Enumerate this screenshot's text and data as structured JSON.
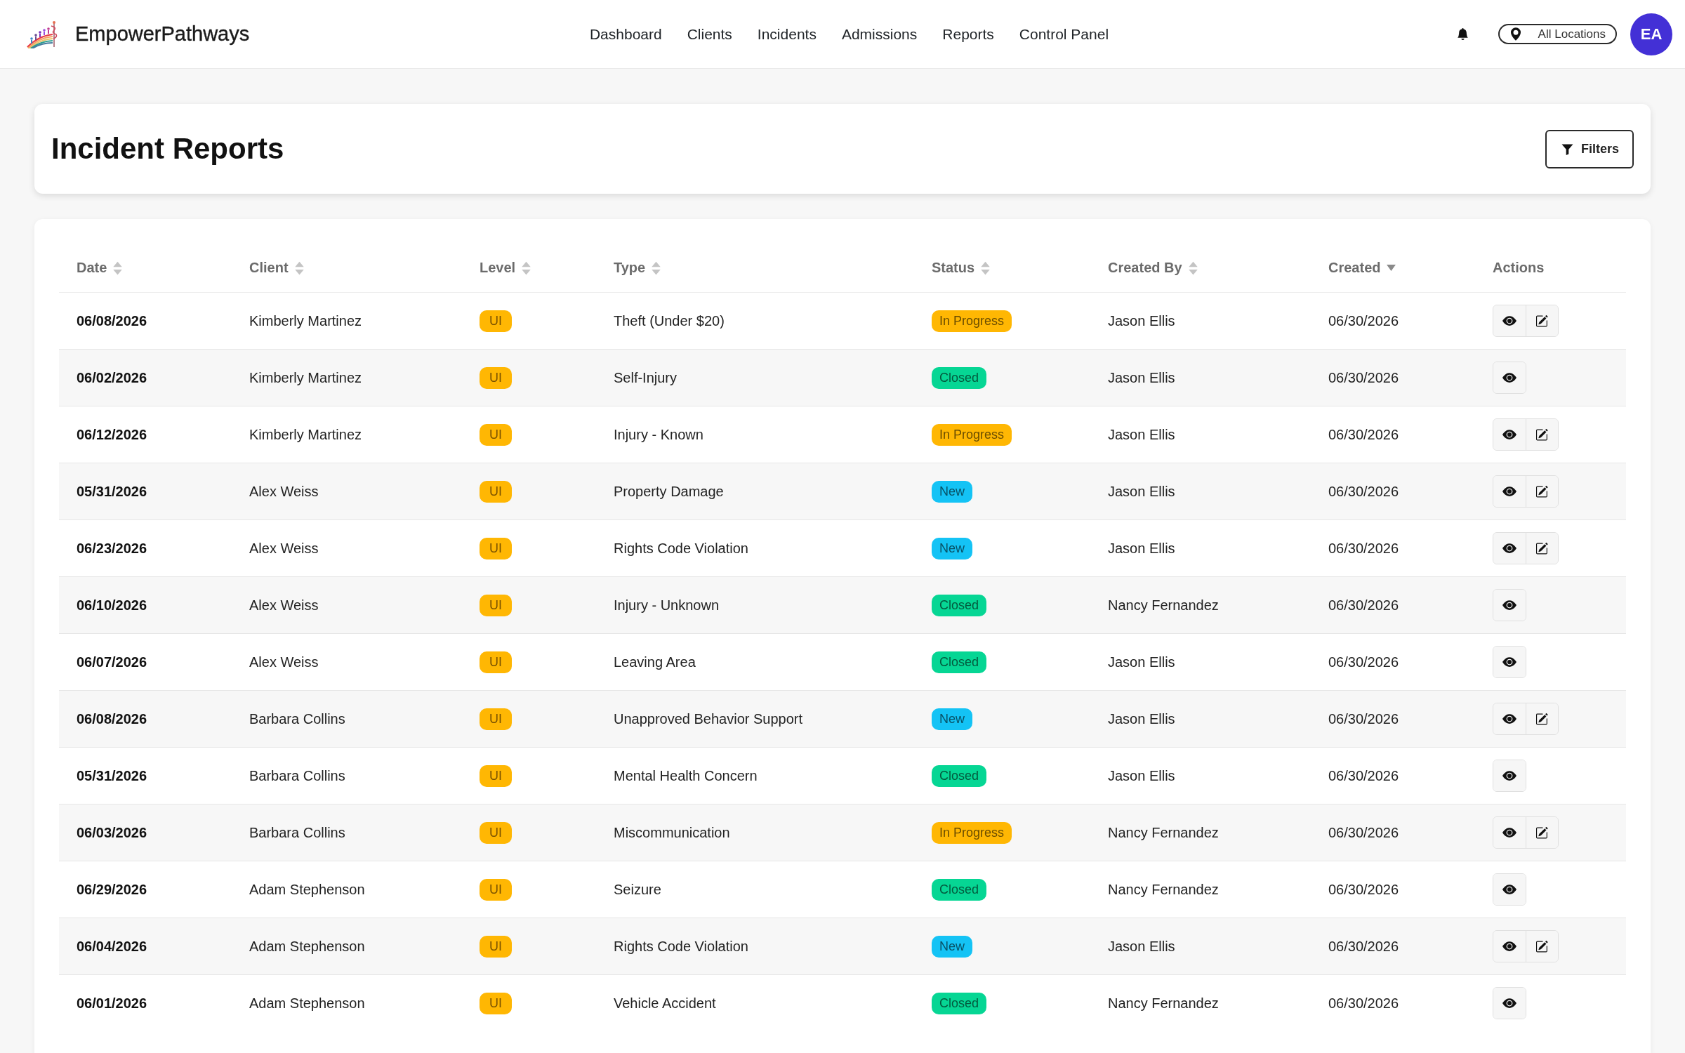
{
  "navbar": {
    "brand": "EmpowerPathways",
    "links": [
      "Dashboard",
      "Clients",
      "Incidents",
      "Admissions",
      "Reports",
      "Control Panel"
    ],
    "location": "All Locations",
    "avatar": "EA"
  },
  "page_header": {
    "title": "Incident Reports",
    "filter_button": "Filters"
  },
  "table": {
    "columns": [
      {
        "label": "Date",
        "sorted": false
      },
      {
        "label": "Client",
        "sorted": false
      },
      {
        "label": "Level",
        "sorted": false
      },
      {
        "label": "Type",
        "sorted": false
      },
      {
        "label": "Status",
        "sorted": false
      },
      {
        "label": "Created By",
        "sorted": false
      },
      {
        "label": "Created",
        "sorted": true
      },
      {
        "label": "Actions"
      }
    ],
    "rows": [
      {
        "date": "06/08/2026",
        "client": "Kimberly Martinez",
        "level": "UI",
        "type": "Theft (Under $20)",
        "status": {
          "label": "In Progress",
          "color": "#ffb703"
        },
        "created_by": "Jason Ellis",
        "created": "06/30/2026",
        "editable": true
      },
      {
        "date": "06/02/2026",
        "client": "Kimberly Martinez",
        "level": "UI",
        "type": "Self-Injury",
        "status": {
          "label": "Closed",
          "color": "#06d694"
        },
        "created_by": "Jason Ellis",
        "created": "06/30/2026",
        "editable": false
      },
      {
        "date": "06/12/2026",
        "client": "Kimberly Martinez",
        "level": "UI",
        "type": "Injury - Known",
        "status": {
          "label": "In Progress",
          "color": "#ffb703"
        },
        "created_by": "Jason Ellis",
        "created": "06/30/2026",
        "editable": true
      },
      {
        "date": "05/31/2026",
        "client": "Alex Weiss",
        "level": "UI",
        "type": "Property Damage",
        "status": {
          "label": "New",
          "color": "#14c3f5"
        },
        "created_by": "Jason Ellis",
        "created": "06/30/2026",
        "editable": true
      },
      {
        "date": "06/23/2026",
        "client": "Alex Weiss",
        "level": "UI",
        "type": "Rights Code Violation",
        "status": {
          "label": "New",
          "color": "#14c3f5"
        },
        "created_by": "Jason Ellis",
        "created": "06/30/2026",
        "editable": true
      },
      {
        "date": "06/10/2026",
        "client": "Alex Weiss",
        "level": "UI",
        "type": "Injury - Unknown",
        "status": {
          "label": "Closed",
          "color": "#06d694"
        },
        "created_by": "Nancy Fernandez",
        "created": "06/30/2026",
        "editable": false
      },
      {
        "date": "06/07/2026",
        "client": "Alex Weiss",
        "level": "UI",
        "type": "Leaving Area",
        "status": {
          "label": "Closed",
          "color": "#06d694"
        },
        "created_by": "Jason Ellis",
        "created": "06/30/2026",
        "editable": false
      },
      {
        "date": "06/08/2026",
        "client": "Barbara Collins",
        "level": "UI",
        "type": "Unapproved Behavior Support",
        "status": {
          "label": "New",
          "color": "#14c3f5"
        },
        "created_by": "Jason Ellis",
        "created": "06/30/2026",
        "editable": true
      },
      {
        "date": "05/31/2026",
        "client": "Barbara Collins",
        "level": "UI",
        "type": "Mental Health Concern",
        "status": {
          "label": "Closed",
          "color": "#06d694"
        },
        "created_by": "Jason Ellis",
        "created": "06/30/2026",
        "editable": false
      },
      {
        "date": "06/03/2026",
        "client": "Barbara Collins",
        "level": "UI",
        "type": "Miscommunication",
        "status": {
          "label": "In Progress",
          "color": "#ffb703"
        },
        "created_by": "Nancy Fernandez",
        "created": "06/30/2026",
        "editable": true
      },
      {
        "date": "06/29/2026",
        "client": "Adam Stephenson",
        "level": "UI",
        "type": "Seizure",
        "status": {
          "label": "Closed",
          "color": "#06d694"
        },
        "created_by": "Nancy Fernandez",
        "created": "06/30/2026",
        "editable": false
      },
      {
        "date": "06/04/2026",
        "client": "Adam Stephenson",
        "level": "UI",
        "type": "Rights Code Violation",
        "status": {
          "label": "New",
          "color": "#14c3f5"
        },
        "created_by": "Jason Ellis",
        "created": "06/30/2026",
        "editable": true
      },
      {
        "date": "06/01/2026",
        "client": "Adam Stephenson",
        "level": "UI",
        "type": "Vehicle Accident",
        "status": {
          "label": "Closed",
          "color": "#06d694"
        },
        "created_by": "Nancy Fernandez",
        "created": "06/30/2026",
        "editable": false
      }
    ]
  }
}
